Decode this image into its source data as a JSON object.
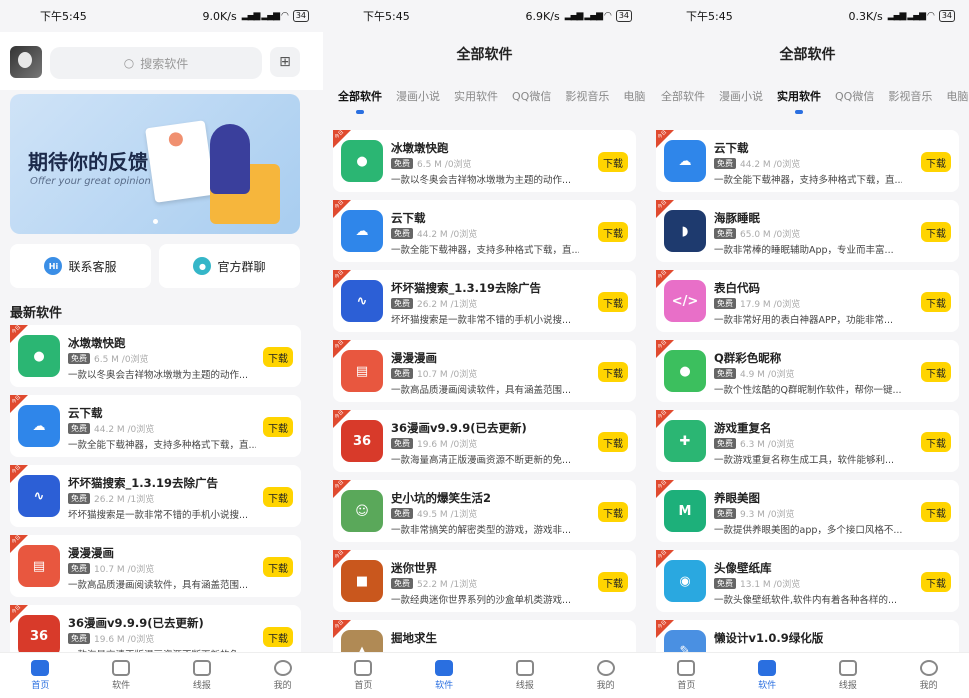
{
  "status": [
    {
      "time": "下午5:45",
      "speed": "9.0K/s",
      "battery": "34"
    },
    {
      "time": "下午5:45",
      "speed": "6.9K/s",
      "battery": "34"
    },
    {
      "time": "下午5:45",
      "speed": "0.3K/s",
      "battery": "34"
    }
  ],
  "home": {
    "search_placeholder": "搜索软件",
    "banner_title": "期待你的反馈",
    "banner_sub": "Offer your great opinion",
    "quick": [
      "联系客服",
      "官方群聊"
    ],
    "section": "最新软件"
  },
  "page_title": "全部软件",
  "tabs": [
    "全部软件",
    "漫画小说",
    "实用软件",
    "QQ微信",
    "影视音乐",
    "电脑!"
  ],
  "tag": "今日",
  "free": "免费",
  "download": "下载",
  "list_all": [
    {
      "name": "冰墩墩快跑",
      "meta": "6.5 M /0浏览",
      "desc": "一款以冬奥会吉祥物冰墩墩为主题的动作...",
      "color": "#2bb673",
      "icon": "panda-icon"
    },
    {
      "name": "云下载",
      "meta": "44.2 M /0浏览",
      "desc": "一款全能下载神器，支持多种格式下载，直...",
      "color": "#2f86ea",
      "icon": "cloud-icon"
    },
    {
      "name": "坏坏猫搜索_1.3.19去除广告",
      "meta": "26.2 M /1浏览",
      "desc": "坏坏猫搜索是一款非常不错的手机小说搜...",
      "color": "#2c5fd6",
      "icon": "wave-icon"
    },
    {
      "name": "漫漫漫画",
      "meta": "10.7 M /0浏览",
      "desc": "一款高品质漫画阅读软件，具有涵盖范围...",
      "color": "#e8573f",
      "icon": "comic-icon"
    },
    {
      "name": "36漫画v9.9.9(已去更新)",
      "meta": "19.6 M /0浏览",
      "desc": "一款海量高清正版漫画资源不断更新的免...",
      "color": "#d83a2a",
      "icon": "36-comic-icon"
    },
    {
      "name": "史小坑的爆笑生活2",
      "meta": "49.5 M /1浏览",
      "desc": "一款非常搞笑的解密类型的游戏，游戏非...",
      "color": "#5aa85a",
      "icon": "game-icon"
    },
    {
      "name": "迷你世界",
      "meta": "52.2 M /1浏览",
      "desc": "一款经典迷你世界系列的沙盒单机类游戏...",
      "color": "#c9571d",
      "icon": "block-icon"
    },
    {
      "name": "掘地求生",
      "meta": "",
      "desc": "",
      "color": "#b08a55",
      "icon": "pot-icon"
    }
  ],
  "home_list_desc_36": "一款海量高清正版漫画资源不断更新的免...",
  "list_util": [
    {
      "name": "云下载",
      "meta": "44.2 M /0浏览",
      "desc": "一款全能下载神器，支持多种格式下载，直...",
      "color": "#2f86ea",
      "icon": "cloud-icon"
    },
    {
      "name": "海豚睡眠",
      "meta": "65.0 M /0浏览",
      "desc": "一款非常棒的睡眠辅助App，专业而丰富...",
      "color": "#1e3a6e",
      "icon": "dolphin-icon"
    },
    {
      "name": "表白代码",
      "meta": "17.9 M /0浏览",
      "desc": "一款非常好用的表白神器APP，功能非常...",
      "color": "#e86fc8",
      "icon": "code-icon"
    },
    {
      "name": "Q群彩色昵称",
      "meta": "4.9 M /0浏览",
      "desc": "一款个性炫酷的Q群昵制作软件，帮你一键...",
      "color": "#3cbf5e",
      "icon": "penguin-icon"
    },
    {
      "name": "游戏重复名",
      "meta": "6.3 M /0浏览",
      "desc": "一款游戏重复名称生成工具，软件能够利...",
      "color": "#2bb673",
      "icon": "gamepad-icon"
    },
    {
      "name": "养眼美图",
      "meta": "9.3 M /0浏览",
      "desc": "一款提供养眼美图的app，多个接口风格不...",
      "color": "#1db07a",
      "icon": "m-icon"
    },
    {
      "name": "头像壁纸库",
      "meta": "13.1 M /0浏览",
      "desc": "一款头像壁纸软件,软件内有着各种各样的...",
      "color": "#2aa8e0",
      "icon": "avatar-lib-icon"
    },
    {
      "name": "懒设计v1.0.9绿化版",
      "meta": "",
      "desc": "",
      "color": "#4a90e2",
      "icon": "design-icon"
    }
  ],
  "nav": [
    "首页",
    "软件",
    "线报",
    "我的"
  ]
}
